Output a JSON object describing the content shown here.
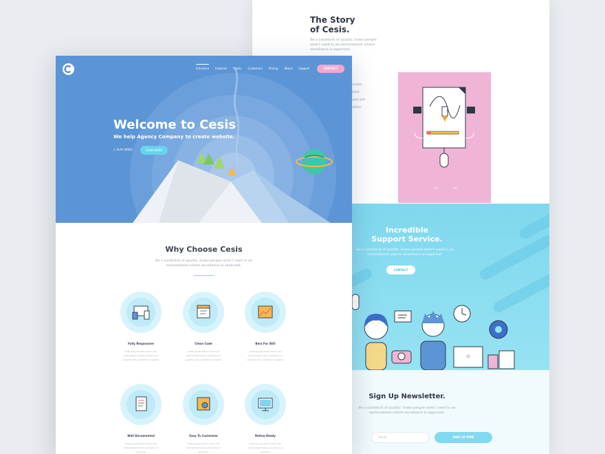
{
  "back_page": {
    "story": {
      "title": "The Story\nof Cesis.",
      "subtitle": "Be a yardstick of quality. Some people aren’t used to an environment where excellence is expected.",
      "partial_text": "ovate,\nbest\nand get\nother"
    },
    "carousel_arrows": "← →",
    "support": {
      "title": "Incredible\nSupport Service.",
      "subtitle": "Be a yardstick of quality. Some people aren’t used to an environment where excellence is expected.",
      "button": "CONTACT"
    },
    "newsletter": {
      "title": "Sign Up Newsletter.",
      "subtitle": "Be a yardstick of quality. Some people aren’t used to an environment where excellence is expected.",
      "email_placeholder": "Email",
      "button": "SIGN UP NOW"
    }
  },
  "front_page": {
    "nav": {
      "items": [
        "Introduce",
        "Features",
        "Works",
        "Customers",
        "Pricing",
        "About",
        "Support"
      ],
      "active": "Introduce",
      "contact": "CONTACT"
    },
    "hero": {
      "title": "Welcome to Cesis",
      "subtitle": "We help Agency Company to create website.",
      "play": "PLAY VIDEO",
      "read_more": "READ MORE"
    },
    "why": {
      "title": "Why Choose Cesis",
      "subtitle": "Be a yardstick of quality. Some people aren’t used to an environment where excellence is expected."
    },
    "features": [
      {
        "title": "Fully Responsive",
        "icon": "devices-icon",
        "desc": "Some people aren’t used to an environment where excellence is expected. Be a yardstick of quality."
      },
      {
        "title": "Clean Code",
        "icon": "code-window-icon",
        "desc": "Some people aren’t used to an environment where excellence is expected. Be a yardstick of quality."
      },
      {
        "title": "Best For SEO",
        "icon": "chart-icon",
        "desc": "Some people aren’t used to an environment where excellence is expected. Be a yardstick of quality."
      },
      {
        "title": "Well Documented",
        "icon": "document-icon",
        "desc": "Some people aren’t used to an environment where excellence is expected."
      },
      {
        "title": "Easy To Customize",
        "icon": "settings-window-icon",
        "desc": "Some people aren’t used to an environment where excellence is expected."
      },
      {
        "title": "Retina Ready",
        "icon": "monitor-icon",
        "desc": "Some people aren’t used to an environment where excellence is expected."
      }
    ]
  },
  "colors": {
    "hero_blue": "#5b95d6",
    "accent_cyan": "#82daf0",
    "accent_pink": "#f5a6cf",
    "background": "#e9ecf0"
  }
}
